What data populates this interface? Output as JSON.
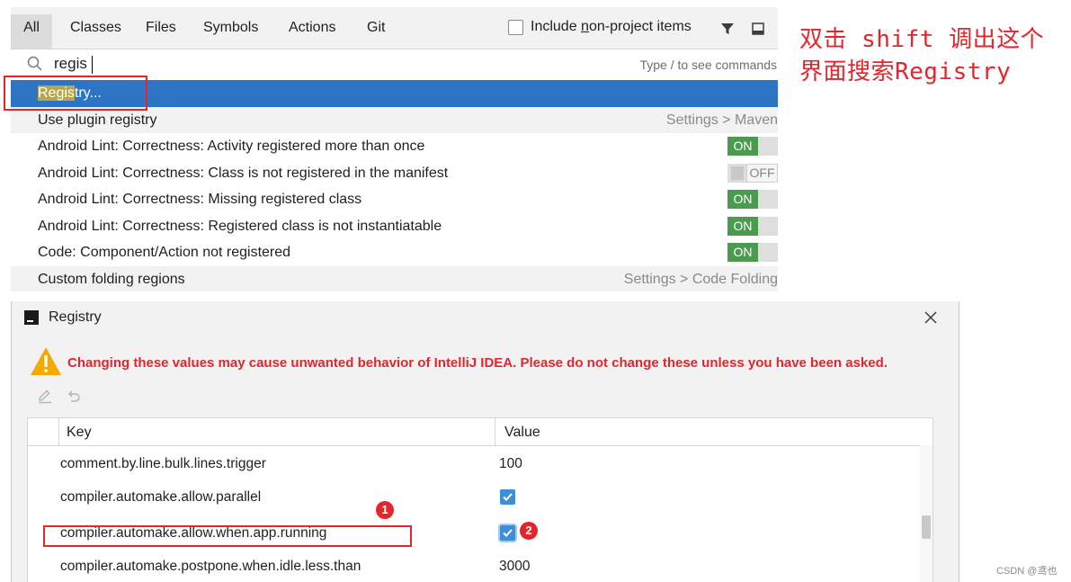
{
  "search_popup": {
    "tabs": [
      {
        "label": "All",
        "active": true
      },
      {
        "label": "Classes"
      },
      {
        "label": "Files"
      },
      {
        "label": "Symbols"
      },
      {
        "label": "Actions"
      },
      {
        "label": "Git"
      }
    ],
    "include_checkbox": {
      "label_pre": "Include ",
      "label_u": "n",
      "label_post": "on-project items",
      "checked": false
    },
    "filter_icon": "filter-icon",
    "preview_icon": "preview-icon",
    "search": {
      "value": "regis",
      "hint": "Type / to see commands"
    },
    "results": [
      {
        "label_hl": "Regis",
        "label_rest": "try...",
        "selected": true
      },
      {
        "label": "Use plugin registry",
        "right": "Settings > Maven",
        "alt": true
      },
      {
        "label": "Android Lint: Correctness: Activity registered more than once",
        "toggle": "ON"
      },
      {
        "label": "Android Lint: Correctness: Class is not registered in the manifest",
        "toggle": "OFF"
      },
      {
        "label": "Android Lint: Correctness: Missing registered class",
        "toggle": "ON"
      },
      {
        "label": "Android Lint: Correctness: Registered class is not instantiatable",
        "toggle": "ON"
      },
      {
        "label": "Code: Component/Action not registered",
        "toggle": "ON"
      },
      {
        "label": "Custom folding regions",
        "right": "Settings > Code Folding",
        "alt": true
      }
    ]
  },
  "annotation": {
    "line1": "双击 shift 调出这个",
    "line2": "界面搜索Registry",
    "color": "#e2262c"
  },
  "registry_dialog": {
    "title": "Registry",
    "warning": "Changing these values may cause unwanted behavior of IntelliJ IDEA. Please do not change these unless you have been asked.",
    "columns": {
      "key": "Key",
      "value": "Value"
    },
    "rows": [
      {
        "key": "comment.by.line.bulk.lines.trigger",
        "value": "100"
      },
      {
        "key": "compiler.automake.allow.parallel",
        "checked": true
      },
      {
        "key": "compiler.automake.allow.when.app.running",
        "checked": true
      },
      {
        "key": "compiler.automake.postpone.when.idle.less.than",
        "value": "3000"
      }
    ]
  },
  "markers": {
    "first": "1",
    "second": "2"
  },
  "watermark": "CSDN @鸢也",
  "colors": {
    "selection": "#2d74c4",
    "toggle_on": "#4a9b4f",
    "annotation_red": "#e2262c"
  }
}
